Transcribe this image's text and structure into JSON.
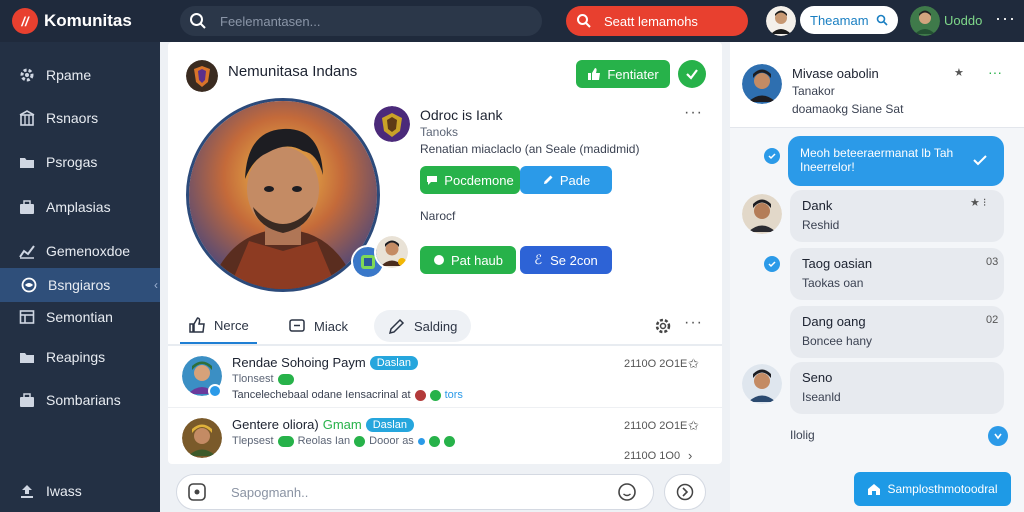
{
  "topbar": {
    "brand": "Komunitas",
    "search_placeholder": "Feelemantasen...",
    "cta_label": "Seatt lemamohs",
    "user_pill": "Theamam",
    "user_name": "Uoddo",
    "more": "···"
  },
  "sidebar": {
    "items": [
      {
        "label": "Rpame",
        "icon": "gear-icon"
      },
      {
        "label": "Rsnaors",
        "icon": "building-icon"
      },
      {
        "label": "Psrogas",
        "icon": "folder-icon"
      },
      {
        "label": "Amplasias",
        "icon": "briefcase-icon"
      },
      {
        "label": "Gemenoxdoe",
        "icon": "chart-icon"
      },
      {
        "label": "Bsngiaros",
        "icon": "globe-icon"
      },
      {
        "label": "Semontian",
        "icon": "layout-icon"
      },
      {
        "label": "Reapings",
        "icon": "folder-icon"
      },
      {
        "label": "Sombarians",
        "icon": "briefcase-icon"
      }
    ],
    "active_index": 5,
    "footer": "Iwass"
  },
  "community": {
    "title": "Nemunitasa Indans",
    "join_label": "Fentiater"
  },
  "profile": {
    "name": "Odroc is Iank",
    "subtitle": "Tanoks",
    "description": "Renatian miaclaclo (an Seale (madidmid)",
    "status": "Narocf",
    "btn_primary": "Pocdemone",
    "btn_secondary": "Pade",
    "btn_green2": "Pat haub",
    "btn_navy": "Se 2con",
    "btn_navy_prefix": "ℰ"
  },
  "tabs": [
    {
      "label": "Nerce",
      "icon": "thumbs-up-icon"
    },
    {
      "label": "Miack",
      "icon": "message-square-icon"
    },
    {
      "label": "Salding",
      "icon": "pencil-icon"
    }
  ],
  "posts": [
    {
      "title": "Rendae Sohoing Paym",
      "tag": "Daslan",
      "sub": "Tlonsest",
      "desc": "Tancelechebaal odane Iensacrinal at",
      "desc_tail": "tors",
      "date": "2110O 2O1E"
    },
    {
      "title": "Gentere oliora)",
      "title_tail": "Gmam",
      "tag": "Daslan",
      "sub": "Tlepsest",
      "sub_tag": "Reolas Ian",
      "desc": "Dooor as",
      "date": "2110O 2O1E",
      "date2": "2110O 1O0"
    }
  ],
  "composer": {
    "placeholder": "Sapogmanh.."
  },
  "chat": {
    "head": {
      "name": "Mivase oabolin",
      "line1": "Tanakor",
      "line2": "doamaokg Siane Sat"
    },
    "bubble_blue": "Meoh beteeraermanat lb Tah Ineerrelor!",
    "messages": [
      {
        "name": "Dank",
        "sub": "Reshid"
      },
      {
        "name": "Taog oasian",
        "sub": "Taokas oan",
        "meta": "03"
      },
      {
        "name": "Dang oang",
        "sub": "Boncee hany",
        "meta": "02"
      },
      {
        "name": "Seno",
        "sub": "Iseanld"
      }
    ],
    "footer_label": "Ilolig",
    "button": "Samplosthmotoodral"
  },
  "colors": {
    "brand": "#e8402f",
    "sidebar": "#233044",
    "green": "#27b24a",
    "blue": "#2b9ae8"
  }
}
